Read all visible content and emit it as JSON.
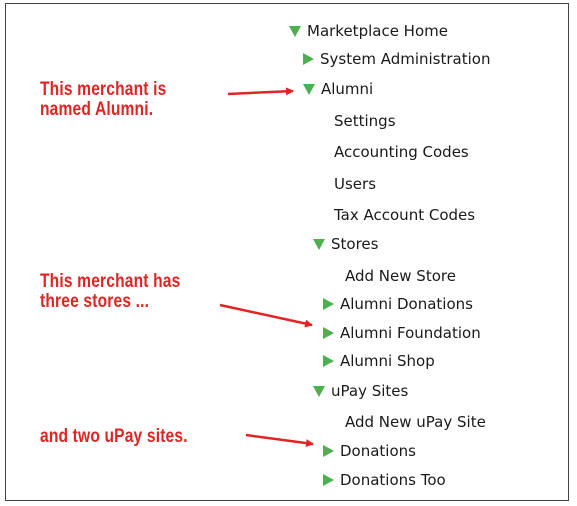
{
  "tree": {
    "marketplace_home": "Marketplace Home",
    "system_administration": "System Administration",
    "alumni": "Alumni",
    "alumni_children": [
      "Settings",
      "Accounting Codes",
      "Users",
      "Tax Account Codes"
    ],
    "stores": "Stores",
    "stores_children": [
      "Add New Store",
      "Alumni Donations",
      "Alumni Foundation",
      "Alumni Shop"
    ],
    "upay_sites": "uPay Sites",
    "upay_children": [
      "Add New uPay Site",
      "Donations",
      "Donations Too"
    ]
  },
  "callouts": {
    "merchant_named": [
      "This merchant is",
      "named Alumni."
    ],
    "three_stores": [
      "This merchant has",
      "three stores ..."
    ],
    "two_upay": "and two uPay sites."
  },
  "colors": {
    "arrow_green": "#4caf50",
    "callout_red": "#e02424"
  }
}
